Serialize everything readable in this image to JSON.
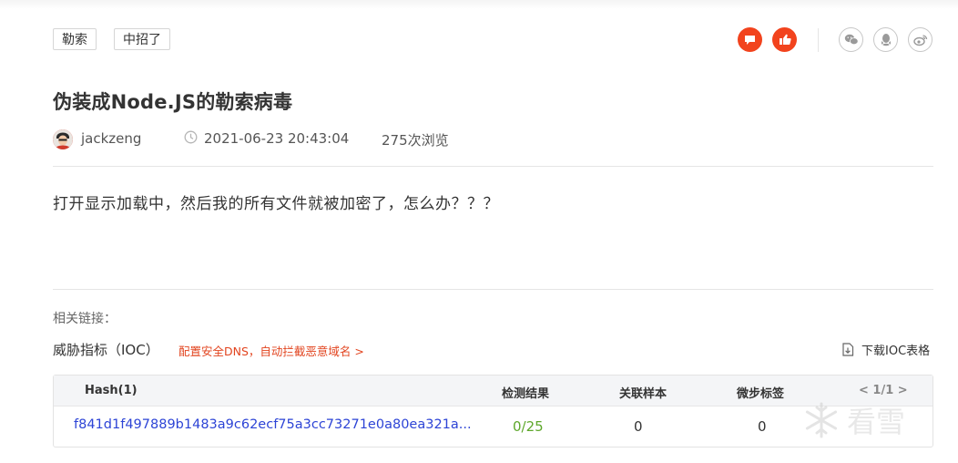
{
  "tags": [
    "勒索",
    "中招了"
  ],
  "title": "伪装成Node.JS的勒索病毒",
  "meta": {
    "author": "jackzeng",
    "datetime": "2021-06-23 20:43:04",
    "views": "275次浏览"
  },
  "body_text": "打开显示加载中，然后我的所有文件就被加密了，怎么办？？？",
  "related": {
    "label": "相关链接："
  },
  "ioc": {
    "label": "威胁指标（IOC）",
    "dns_link": "配置安全DNS，自动拦截恶意域名 >",
    "download_label": "下载IOC表格"
  },
  "table": {
    "headers": {
      "hash": "Hash(1)",
      "result": "检测结果",
      "samples": "关联样本",
      "tags": "微步标签",
      "pager": "< 1/1 >"
    },
    "row": {
      "hash": "f841d1f497889b1483a9c62ecf75a3cc73271e0a80ea321a...",
      "result": "0/25",
      "samples": "0",
      "tags": "0"
    }
  },
  "watermark": "看雪",
  "colors": {
    "accent_red": "#f2431d",
    "link_red": "#e2441f",
    "hash_blue": "#2d44d6",
    "result_green": "#5ea72b"
  },
  "icons": {
    "comment": "comment-icon",
    "like": "thumbs-up-icon",
    "wechat": "wechat-icon",
    "qq": "qq-icon",
    "weibo": "weibo-icon",
    "clock": "clock-icon",
    "download": "download-icon"
  }
}
